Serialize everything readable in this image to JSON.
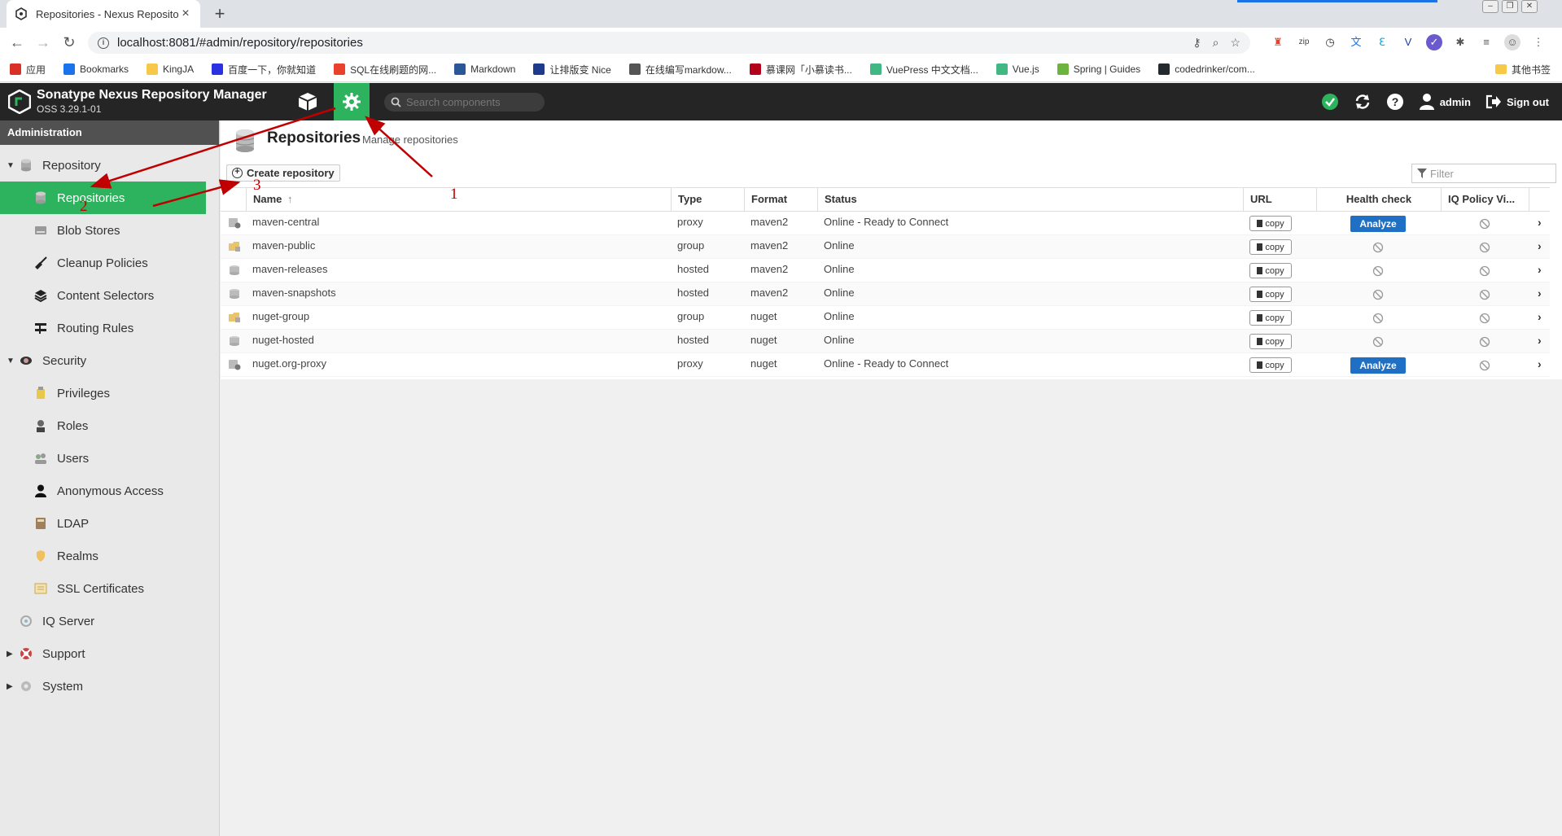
{
  "browser": {
    "tab_title": "Repositories - Nexus Reposito",
    "tab_close": "×",
    "new_tab": "+",
    "url": "localhost:8081/#admin/repository/repositories",
    "bookmarks": [
      {
        "label": "应用",
        "color": "#d93025",
        "icon": "apps-icon"
      },
      {
        "label": "Bookmarks",
        "color": "#1a73e8",
        "icon": "star-icon"
      },
      {
        "label": "KingJA",
        "color": "#f7c948",
        "icon": "folder-icon"
      },
      {
        "label": "百度一下，你就知道",
        "color": "#2932e1",
        "icon": "baidu-icon"
      },
      {
        "label": "SQL在线刷题的网...",
        "color": "#e8412c",
        "icon": "sql-icon"
      },
      {
        "label": "Markdown",
        "color": "#2b5797",
        "icon": "markdown-icon"
      },
      {
        "label": "让排版变 Nice",
        "color": "#1e3a8a",
        "icon": "nice-icon"
      },
      {
        "label": "在线编写markdow...",
        "color": "#555555",
        "icon": "grid-icon"
      },
      {
        "label": "慕课网「小慕读书...",
        "color": "#b3001b",
        "icon": "imooc-icon"
      },
      {
        "label": "VuePress 中文文档...",
        "color": "#41b883",
        "icon": "vue-icon"
      },
      {
        "label": "Vue.js",
        "color": "#41b883",
        "icon": "vue-icon"
      },
      {
        "label": "Spring | Guides",
        "color": "#6db33f",
        "icon": "spring-icon"
      },
      {
        "label": "codedrinker/com...",
        "color": "#24292e",
        "icon": "github-icon"
      }
    ],
    "other_bookmarks": "其他书签"
  },
  "app": {
    "title": "Sonatype Nexus Repository Manager",
    "version": "OSS 3.29.1-01",
    "search_placeholder": "Search components",
    "user": "admin",
    "sign_out": "Sign out",
    "accent": "#2db35d"
  },
  "sidebar": {
    "header": "Administration",
    "items": [
      {
        "label": "Repository",
        "level": 0,
        "tri": "▼",
        "icon": "database-icon"
      },
      {
        "label": "Repositories",
        "level": 1,
        "icon": "database-icon",
        "selected": true
      },
      {
        "label": "Blob Stores",
        "level": 1,
        "icon": "hdd-icon"
      },
      {
        "label": "Cleanup Policies",
        "level": 1,
        "icon": "broom-icon"
      },
      {
        "label": "Content Selectors",
        "level": 1,
        "icon": "layers-icon"
      },
      {
        "label": "Routing Rules",
        "level": 1,
        "icon": "routing-icon"
      },
      {
        "label": "Security",
        "level": 0,
        "tri": "▼",
        "icon": "eye-icon"
      },
      {
        "label": "Privileges",
        "level": 1,
        "icon": "badge-icon"
      },
      {
        "label": "Roles",
        "level": 1,
        "icon": "role-icon"
      },
      {
        "label": "Users",
        "level": 1,
        "icon": "users-icon"
      },
      {
        "label": "Anonymous Access",
        "level": 1,
        "icon": "user-icon"
      },
      {
        "label": "LDAP",
        "level": 1,
        "icon": "book-icon"
      },
      {
        "label": "Realms",
        "level": 1,
        "icon": "shield-icon"
      },
      {
        "label": "SSL Certificates",
        "level": 1,
        "icon": "certificate-icon"
      },
      {
        "label": "IQ Server",
        "level": 0,
        "tri": "",
        "icon": "iq-icon"
      },
      {
        "label": "Support",
        "level": 0,
        "tri": "▶",
        "icon": "lifebuoy-icon"
      },
      {
        "label": "System",
        "level": 0,
        "tri": "▶",
        "icon": "gear-icon"
      }
    ]
  },
  "page": {
    "title": "Repositories",
    "subtitle": "Manage repositories",
    "create_button": "Create repository",
    "filter_placeholder": "Filter"
  },
  "grid": {
    "columns": [
      "Name",
      "Type",
      "Format",
      "Status",
      "URL",
      "Health check",
      "IQ Policy Vi..."
    ],
    "sort_arrow": "↑",
    "copy_label": "copy",
    "analyze_label": "Analyze",
    "rows": [
      {
        "name": "maven-central",
        "type": "proxy",
        "format": "maven2",
        "status": "Online - Ready to Connect",
        "health": "analyze",
        "icon": "proxy"
      },
      {
        "name": "maven-public",
        "type": "group",
        "format": "maven2",
        "status": "Online",
        "health": "na",
        "icon": "group"
      },
      {
        "name": "maven-releases",
        "type": "hosted",
        "format": "maven2",
        "status": "Online",
        "health": "na",
        "icon": "hosted"
      },
      {
        "name": "maven-snapshots",
        "type": "hosted",
        "format": "maven2",
        "status": "Online",
        "health": "na",
        "icon": "hosted"
      },
      {
        "name": "nuget-group",
        "type": "group",
        "format": "nuget",
        "status": "Online",
        "health": "na",
        "icon": "group"
      },
      {
        "name": "nuget-hosted",
        "type": "hosted",
        "format": "nuget",
        "status": "Online",
        "health": "na",
        "icon": "hosted"
      },
      {
        "name": "nuget.org-proxy",
        "type": "proxy",
        "format": "nuget",
        "status": "Online - Ready to Connect",
        "health": "analyze",
        "icon": "proxy"
      }
    ]
  },
  "annotations": {
    "labels": [
      "1",
      "2",
      "3"
    ],
    "color": "#c00000"
  }
}
